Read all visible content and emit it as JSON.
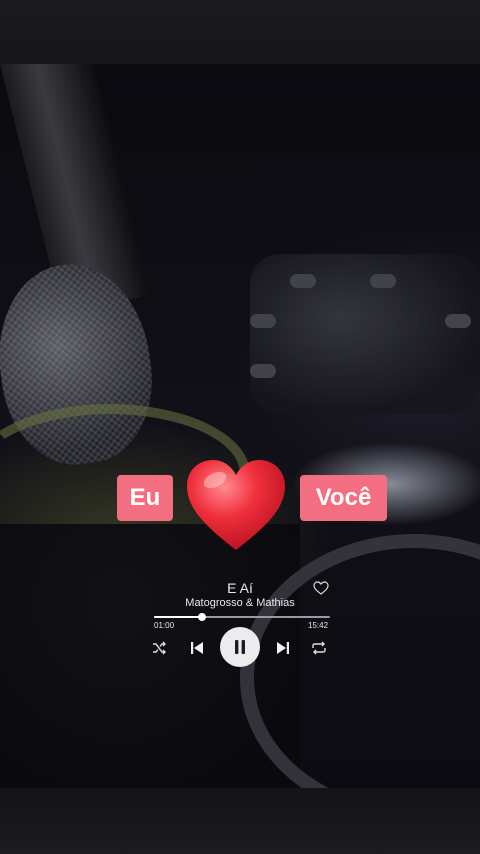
{
  "overlay": {
    "left_chip": "Eu",
    "right_chip": "Você",
    "chip_color": "#f26e80",
    "heart_icon": "red-heart",
    "heart_color": "#ef2f3c"
  },
  "player": {
    "title": "E Aí",
    "artist": "Matogrosso & Mathias",
    "elapsed": "01:00",
    "total": "15:42",
    "progress": 0.27,
    "playing": true,
    "icons": {
      "like": "heart-outline-icon",
      "shuffle": "shuffle-icon",
      "previous": "skip-previous-icon",
      "play_pause": "pause-icon",
      "next": "skip-next-icon",
      "repeat": "repeat-icon"
    }
  }
}
